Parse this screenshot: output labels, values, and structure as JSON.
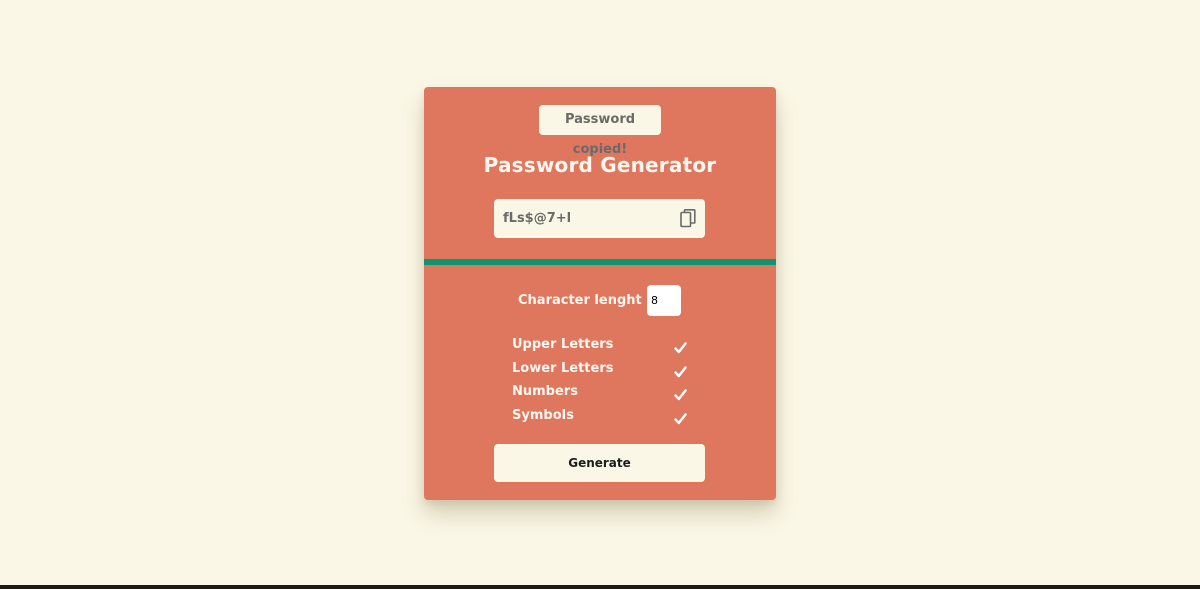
{
  "toast": {
    "text": "Password copied!"
  },
  "app": {
    "title": "Password Generator"
  },
  "password": {
    "value": "fLs$@7+l"
  },
  "length": {
    "label": "Character lenght is:",
    "value": "8"
  },
  "options": [
    {
      "label": "Upper Letters",
      "checked": true
    },
    {
      "label": "Lower Letters",
      "checked": true
    },
    {
      "label": "Numbers",
      "checked": true
    },
    {
      "label": "Symbols",
      "checked": true
    }
  ],
  "actions": {
    "generate_label": "Generate"
  },
  "colors": {
    "background": "#fbf7e6",
    "card": "#df775f",
    "strength": "#0e9470",
    "text_light": "#fff6ef"
  },
  "icons": {
    "copy": "copy-icon",
    "check": "check-icon"
  }
}
